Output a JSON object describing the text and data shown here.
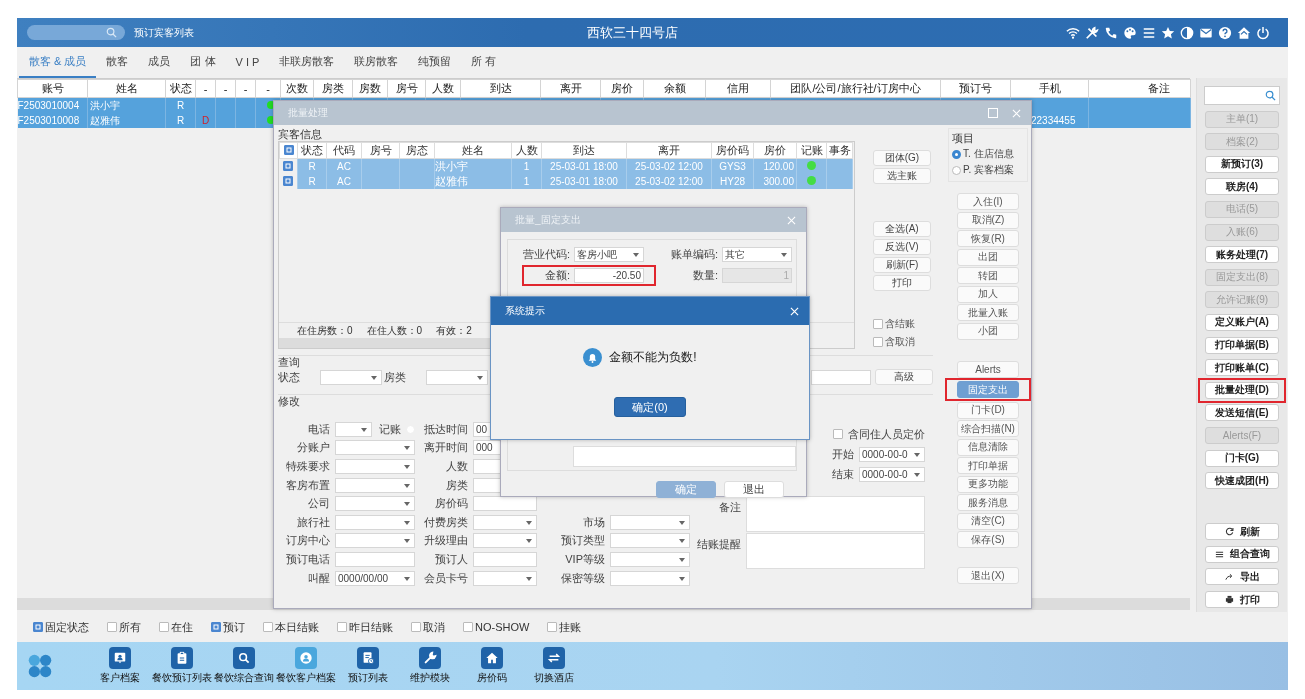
{
  "header": {
    "link": "预订宾客列表",
    "title": "西软三十四号店"
  },
  "tabs": [
    {
      "label": "散客 & 成员",
      "selected": true
    },
    {
      "label": "散客",
      "selected": false
    },
    {
      "label": "成员",
      "selected": false
    },
    {
      "label": "团 体",
      "selected": false
    },
    {
      "label": "V I P",
      "selected": false
    },
    {
      "label": "非联房散客",
      "selected": false
    },
    {
      "label": "联房散客",
      "selected": false
    },
    {
      "label": "纯预留",
      "selected": false
    },
    {
      "label": "所 有",
      "selected": false
    }
  ],
  "table": {
    "columns": [
      "账号",
      "姓名",
      "状态",
      "-",
      "-",
      "-",
      "-",
      "次数",
      "房类",
      "房数",
      "房号",
      "人数",
      "到达",
      "离开",
      "房价",
      "余额",
      "信用",
      "团队/公司/旅行社/订房中心",
      "预订号",
      "手机",
      "备注"
    ],
    "rows": [
      {
        "account": "F2503010004",
        "name": "洪小宇",
        "status": "R",
        "dot": true,
        "selected": true
      },
      {
        "account": "F2503010008",
        "name": "赵雅伟",
        "status": "R",
        "flag": "D",
        "dot": true,
        "phone": "22334455",
        "selected": true
      }
    ]
  },
  "sidebar": {
    "buttons": [
      {
        "label": "主单(1)",
        "disabled": true,
        "highlighted": false
      },
      {
        "label": "档案(2)",
        "disabled": true,
        "highlighted": false
      },
      {
        "label": "新预订(3)",
        "disabled": false,
        "highlighted": false
      },
      {
        "label": "联房(4)",
        "disabled": false,
        "highlighted": false
      },
      {
        "label": "电话(5)",
        "disabled": true,
        "highlighted": false
      },
      {
        "label": "入账(6)",
        "disabled": true,
        "highlighted": false
      },
      {
        "label": "账务处理(7)",
        "disabled": false,
        "highlighted": false
      },
      {
        "label": "固定支出(8)",
        "disabled": true,
        "highlighted": false
      },
      {
        "label": "允许记账(9)",
        "disabled": true,
        "highlighted": false
      },
      {
        "label": "定义账户(A)",
        "disabled": false,
        "highlighted": false
      },
      {
        "label": "打印单据(B)",
        "disabled": false,
        "highlighted": false
      },
      {
        "label": "打印账单(C)",
        "disabled": false,
        "highlighted": false
      },
      {
        "label": "批量处理(D)",
        "disabled": false,
        "highlighted": true
      },
      {
        "label": "发送短信(E)",
        "disabled": false,
        "highlighted": false
      },
      {
        "label": "Alerts(F)",
        "disabled": true,
        "highlighted": false
      },
      {
        "label": "门卡(G)",
        "disabled": false,
        "highlighted": false
      },
      {
        "label": "快速成团(H)",
        "disabled": false,
        "highlighted": false
      }
    ],
    "tools": [
      {
        "label": "刷新",
        "kind": "refresh"
      },
      {
        "label": "组合查询",
        "kind": "list"
      },
      {
        "label": "导出",
        "kind": "export"
      },
      {
        "label": "打印",
        "kind": "print"
      }
    ]
  },
  "filters": [
    {
      "label": "固定状态",
      "checked": true
    },
    {
      "label": "所有",
      "checked": false
    },
    {
      "label": "在住",
      "checked": false
    },
    {
      "label": "预订",
      "checked": true
    },
    {
      "label": "本日结账",
      "checked": false
    },
    {
      "label": "昨日结账",
      "checked": false
    },
    {
      "label": "取消",
      "checked": false
    },
    {
      "label": "NO-SHOW",
      "checked": false
    },
    {
      "label": "挂账",
      "checked": false
    }
  ],
  "dock": [
    {
      "label": "客户档案",
      "kind": "contact",
      "selected": false
    },
    {
      "label": "餐饮预订列表",
      "kind": "clipboard",
      "selected": false
    },
    {
      "label": "餐饮综合查询",
      "kind": "search",
      "selected": false
    },
    {
      "label": "餐饮客户档案",
      "kind": "user",
      "selected": true
    },
    {
      "label": "预订列表",
      "kind": "document",
      "selected": false
    },
    {
      "label": "维护模块",
      "kind": "wrench",
      "selected": false
    },
    {
      "label": "房价码",
      "kind": "home",
      "selected": false
    },
    {
      "label": "切换酒店",
      "kind": "swap",
      "selected": false
    }
  ],
  "batch_dialog": {
    "title": "批量处理",
    "guest_section": "宾客信息",
    "all_checked": true,
    "columns": [
      "状态",
      "代码",
      "房号",
      "房态",
      "姓名",
      "人数",
      "到达",
      "离开",
      "房价码",
      "房价",
      "记账",
      "事务"
    ],
    "rows": [
      {
        "checked": true,
        "selected": true,
        "status": "R",
        "code": "AC",
        "name": "洪小宇",
        "guests": "1",
        "arrival": "25-03-01 18:00",
        "departure": "25-03-02 12:00",
        "rate_code": "GYS3",
        "rate": "120.00",
        "posted": true
      },
      {
        "checked": true,
        "selected": true,
        "status": "R",
        "code": "AC",
        "name": "赵雅伟",
        "guests": "1",
        "arrival": "25-03-01 18:00",
        "departure": "25-03-02 12:00",
        "rate_code": "HY28",
        "rate": "300.00",
        "posted": true
      }
    ],
    "summary": [
      "在住房数：0",
      "在住人数：0",
      "有效：2"
    ],
    "group_buttons": [
      "团体(G)",
      "选主账"
    ],
    "select_buttons": [
      "全选(A)",
      "反选(V)",
      "刷新(F)",
      "打印"
    ],
    "options": [
      {
        "label": "含结账",
        "checked": false
      },
      {
        "label": "含取消",
        "checked": false
      }
    ],
    "items_label": "项目",
    "items": [
      {
        "label": "T. 住店信息",
        "selected": true
      },
      {
        "label": "P. 宾客档案",
        "selected": false
      }
    ],
    "actions": [
      [
        {
          "label": "入住(I)",
          "selected": false,
          "highlighted": false
        },
        {
          "label": "取消(Z)",
          "selected": false,
          "highlighted": false
        },
        {
          "label": "恢复(R)",
          "selected": false,
          "highlighted": false
        },
        {
          "label": "出团",
          "selected": false,
          "highlighted": false
        },
        {
          "label": "转团",
          "selected": false,
          "highlighted": false
        },
        {
          "label": "加人",
          "selected": false,
          "highlighted": false
        },
        {
          "label": "批量入账",
          "selected": false,
          "highlighted": false
        },
        {
          "label": "小团",
          "selected": false,
          "highlighted": false
        }
      ],
      [
        {
          "label": "Alerts",
          "selected": false,
          "highlighted": false
        },
        {
          "label": "固定支出",
          "selected": true,
          "highlighted": true
        },
        {
          "label": "门卡(D)",
          "selected": false,
          "highlighted": false
        },
        {
          "label": "综合扫描(N)",
          "selected": false,
          "highlighted": false
        },
        {
          "label": "信息清除",
          "selected": false,
          "highlighted": false
        },
        {
          "label": "打印单据",
          "selected": false,
          "highlighted": false
        },
        {
          "label": "更多功能",
          "selected": false,
          "highlighted": false
        },
        {
          "label": "服务消息",
          "selected": false,
          "highlighted": false
        },
        {
          "label": "清空(C)",
          "selected": false,
          "highlighted": false
        },
        {
          "label": "保存(S)",
          "selected": false,
          "highlighted": false
        }
      ],
      [
        {
          "label": "退出(X)",
          "selected": false,
          "highlighted": false
        }
      ]
    ],
    "query": {
      "label": "查询",
      "fields": [
        {
          "label": "状态"
        },
        {
          "label": "房类"
        }
      ],
      "advanced": "高级"
    },
    "modify": {
      "label": "修改",
      "columns": [
        [
          {
            "label": "电话",
            "kind": "phone",
            "extra": "记账",
            "extra_checked": false
          },
          {
            "label": "分账户",
            "kind": "select"
          },
          {
            "label": "特殊要求",
            "kind": "select"
          },
          {
            "label": "客房布置",
            "kind": "select"
          },
          {
            "label": "公司",
            "kind": "select"
          },
          {
            "label": "旅行社",
            "kind": "select"
          },
          {
            "label": "订房中心",
            "kind": "select"
          },
          {
            "label": "预订电话",
            "kind": "text"
          },
          {
            "label": "叫醒",
            "kind": "select",
            "value": "0000/00/00"
          }
        ],
        [
          {
            "label": "抵达时间",
            "kind": "text",
            "value": "00"
          },
          {
            "label": "离开时间",
            "kind": "text",
            "value": "000"
          },
          {
            "label": "人数",
            "kind": "text"
          },
          {
            "label": "房类",
            "kind": "text"
          },
          {
            "label": "房价码",
            "kind": "text"
          },
          {
            "label": "付费房类",
            "kind": "select"
          },
          {
            "label": "升级理由",
            "kind": "select"
          },
          {
            "label": "预订人",
            "kind": "text"
          },
          {
            "label": "会员卡号",
            "kind": "select"
          }
        ],
        [
          {
            "label": "市场",
            "kind": "select"
          },
          {
            "label": "预订类型",
            "kind": "select"
          },
          {
            "label": "VIP等级",
            "kind": "select"
          },
          {
            "label": "保密等级",
            "kind": "select"
          }
        ],
        [
          {
            "label": "含同住人员定价",
            "kind": "checkbox",
            "checked": false
          },
          {
            "label": "开始",
            "kind": "select",
            "value": "0000-00-0"
          },
          {
            "label": "结束",
            "kind": "select",
            "value": "0000-00-0"
          },
          {
            "label": "备注",
            "kind": "textarea"
          },
          {
            "label": "结账提醒",
            "kind": "textarea"
          }
        ]
      ]
    }
  },
  "expense_dialog": {
    "title": "批量_固定支出",
    "fields": [
      {
        "label": "营业代码:",
        "kind": "select",
        "value": "客房小吧",
        "highlighted": false
      },
      {
        "label": "账单编码:",
        "kind": "select",
        "value": "其它",
        "highlighted": false
      },
      {
        "label": "金额:",
        "kind": "text",
        "value": "-20.50",
        "highlighted": true,
        "disabled": false
      },
      {
        "label": "数量:",
        "kind": "text",
        "value": "1",
        "highlighted": false,
        "disabled": true
      }
    ],
    "buttons": [
      {
        "label": "确定",
        "disabled": true
      },
      {
        "label": "退出",
        "disabled": false
      }
    ]
  },
  "alert": {
    "title": "系统提示",
    "message": "金额不能为负数!",
    "button": "确定(0)"
  }
}
